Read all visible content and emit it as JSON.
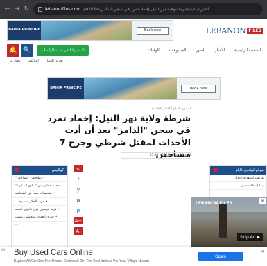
{
  "browser": {
    "back": "←",
    "forward": "→",
    "reload": "↻",
    "url_domain": "lebanonfiles.com",
    "url_path": "/articles/أخبار-لبنانية/شرطة-ولاية-نهر-النيل-إخماد-تمرد-في-سجن-الدامر"
  },
  "top_ad": {
    "brand": "BAHIA PRINCIPE",
    "button": "Book now"
  },
  "logo": {
    "word": "LEBANON",
    "tag": "FILES"
  },
  "nav": {
    "bell": "🔔",
    "search": "🔍",
    "whatsapp": "شاركنا عبر خدمة الواتساب",
    "links": [
      "الصفحة الرئيسية",
      "الأخبار",
      "الصور",
      "الفيديوهات",
      "الوفيات"
    ],
    "row2": [
      "إتصل بنا",
      "إعلانكم",
      "تحرير العمل"
    ]
  },
  "mid_ad": {
    "brand": "BAHIA PRINCIPE",
    "button": "Book now"
  },
  "article": {
    "breadcrumb": "ليبانون فايلز / أخبار العالمية",
    "headline": "شرطة ولاية نهر النيل: إخماد تمرد في سجن \"الدامر\" بعد أن أدت الأحداث لمقتل شرطي وجرح 7 مساجين",
    "date": "الأحد 30 نيسان 2023 - 11:34"
  },
  "left_widget": {
    "title": "كواليس",
    "items": [
      "تطاحنون \"بتطاحون\"",
      "محمد حجازي من \"سابق الشكرية\"",
      "شخصيات بعيداً عن الشفافية",
      "حزب الحلال مسيرة ...",
      "قرية عرسرن قرار قانوني البلديـ",
      "خوري العمادي وتحشيي بسبب",
      "..."
    ]
  },
  "share": {
    "items": [
      "<",
      "f",
      "y",
      "w",
      "p",
      "A+",
      "A-"
    ]
  },
  "right_widget": {
    "title": "موقع ليبانون فايلز",
    "items": [
      "ما تقيد استقدام الدولار",
      "بيدا أصطلت هيس"
    ]
  },
  "video_ad": {
    "logo": "LEBANON FILES",
    "skip": "Skip Ad ▶",
    "close": "×"
  },
  "bottom_ad": {
    "tag": "Ad",
    "title": "Buy Used Cars Online",
    "desc": "Explore All Certified Pre-Owned Options & Get The Best Vehicle For You. Village Nissan",
    "button": "Open",
    "close": "×"
  },
  "colors": {
    "brand_blue": "#1f4f8a",
    "brand_red": "#c4272d",
    "whatsapp_green": "#25a245",
    "cta_blue": "#1a73e8"
  }
}
